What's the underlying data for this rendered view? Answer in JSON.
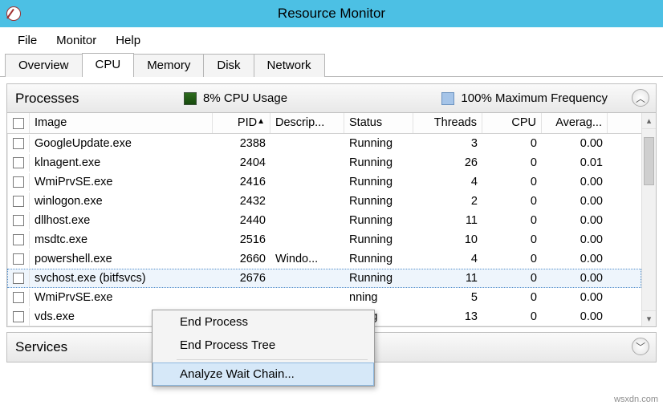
{
  "window": {
    "title": "Resource Monitor"
  },
  "menubar": {
    "file": "File",
    "monitor": "Monitor",
    "help": "Help"
  },
  "tabs": {
    "overview": "Overview",
    "cpu": "CPU",
    "memory": "Memory",
    "disk": "Disk",
    "network": "Network"
  },
  "processes_panel": {
    "title": "Processes",
    "cpu_usage": "8% CPU Usage",
    "max_freq": "100% Maximum Frequency",
    "columns": {
      "image": "Image",
      "pid": "PID",
      "description": "Descrip...",
      "status": "Status",
      "threads": "Threads",
      "cpu": "CPU",
      "avg": "Averag..."
    },
    "rows": [
      {
        "image": "GoogleUpdate.exe",
        "pid": "2388",
        "desc": "",
        "status": "Running",
        "threads": "3",
        "cpu": "0",
        "avg": "0.00"
      },
      {
        "image": "klnagent.exe",
        "pid": "2404",
        "desc": "",
        "status": "Running",
        "threads": "26",
        "cpu": "0",
        "avg": "0.01"
      },
      {
        "image": "WmiPrvSE.exe",
        "pid": "2416",
        "desc": "",
        "status": "Running",
        "threads": "4",
        "cpu": "0",
        "avg": "0.00"
      },
      {
        "image": "winlogon.exe",
        "pid": "2432",
        "desc": "",
        "status": "Running",
        "threads": "2",
        "cpu": "0",
        "avg": "0.00"
      },
      {
        "image": "dllhost.exe",
        "pid": "2440",
        "desc": "",
        "status": "Running",
        "threads": "11",
        "cpu": "0",
        "avg": "0.00"
      },
      {
        "image": "msdtc.exe",
        "pid": "2516",
        "desc": "",
        "status": "Running",
        "threads": "10",
        "cpu": "0",
        "avg": "0.00"
      },
      {
        "image": "powershell.exe",
        "pid": "2660",
        "desc": "Windo...",
        "status": "Running",
        "threads": "4",
        "cpu": "0",
        "avg": "0.00"
      },
      {
        "image": "svchost.exe (bitfsvcs)",
        "pid": "2676",
        "desc": "",
        "status": "Running",
        "threads": "11",
        "cpu": "0",
        "avg": "0.00",
        "selected": true
      },
      {
        "image": "WmiPrvSE.exe",
        "pid": "",
        "desc": "",
        "status": "nning",
        "threads": "5",
        "cpu": "0",
        "avg": "0.00"
      },
      {
        "image": "vds.exe",
        "pid": "",
        "desc": "",
        "status": "nning",
        "threads": "13",
        "cpu": "0",
        "avg": "0.00"
      }
    ]
  },
  "services_panel": {
    "title": "Services"
  },
  "context_menu": {
    "end_process": "End Process",
    "end_tree": "End Process Tree",
    "analyze": "Analyze Wait Chain..."
  },
  "watermark": "wsxdn.com"
}
